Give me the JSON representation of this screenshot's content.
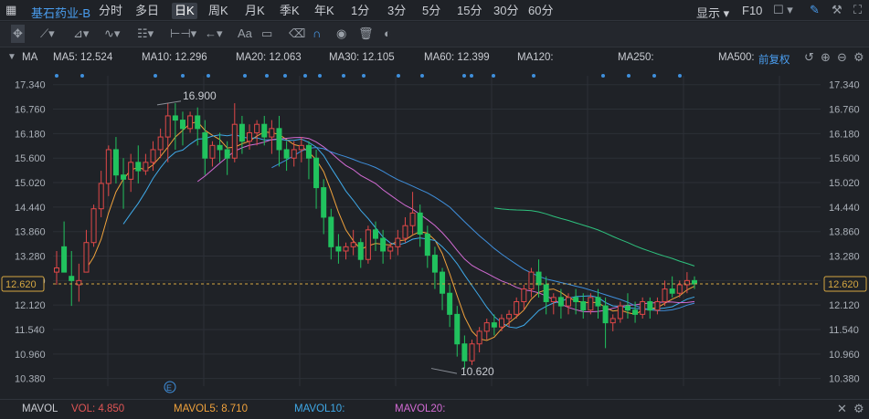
{
  "header": {
    "stock_name": "基石药业-B",
    "tabs": [
      "分时",
      "多日",
      "日K",
      "周K",
      "月K",
      "季K",
      "年K",
      "1分",
      "3分",
      "5分",
      "15分",
      "30分",
      "60分"
    ],
    "active_tab": "日K",
    "display_label": "显示",
    "f10_label": "F10"
  },
  "ma_bar": {
    "label": "MA",
    "ma5": "MA5: 12.524",
    "ma10": "MA10: 12.296",
    "ma20": "MA20: 12.063",
    "ma30": "MA30: 12.105",
    "ma60": "MA60: 12.399",
    "ma120": "MA120:",
    "ma250": "MA250:",
    "ma500": "MA500:",
    "adjust": "前复权"
  },
  "colors": {
    "ma5": "#f0a23c",
    "ma10": "#3fa9e8",
    "ma20": "#d36bd4",
    "ma30": "#3f8fdc",
    "ma60": "#2ec27e",
    "ma120": "#e05555",
    "ma250": "#4fd0e8",
    "ma500": "#8a6a2a",
    "up": "#e04848",
    "down": "#21c25e",
    "current": "#d4a641"
  },
  "chart_data": {
    "type": "candlestick",
    "y_ticks": [
      "17.340",
      "16.760",
      "16.180",
      "15.600",
      "15.020",
      "14.440",
      "13.860",
      "13.280",
      "12.700",
      "12.120",
      "11.540",
      "10.960",
      "10.380"
    ],
    "ylim": [
      10.2,
      17.55
    ],
    "current_price": "12.620",
    "annotation_high": "16.900",
    "annotation_low": "10.620",
    "candles": [
      [
        12.9,
        13.4,
        13.0,
        12.6
      ],
      [
        13.5,
        14.1,
        12.9,
        13.5
      ],
      [
        12.8,
        13.4,
        12.7,
        12.1
      ],
      [
        12.6,
        13.1,
        12.7,
        12.2
      ],
      [
        12.9,
        13.9,
        13.6,
        12.9
      ],
      [
        13.6,
        14.5,
        14.4,
        13.5
      ],
      [
        14.4,
        15.3,
        15.0,
        14.2
      ],
      [
        15.0,
        15.9,
        15.8,
        14.7
      ],
      [
        15.8,
        16.1,
        15.2,
        15.0
      ],
      [
        15.2,
        15.6,
        15.1,
        14.4
      ],
      [
        15.1,
        15.7,
        15.5,
        14.8
      ],
      [
        15.5,
        15.9,
        15.3,
        15.0
      ],
      [
        15.3,
        15.7,
        15.5,
        15.2
      ],
      [
        15.5,
        16.0,
        15.8,
        15.3
      ],
      [
        15.8,
        16.3,
        16.1,
        15.6
      ],
      [
        16.1,
        16.9,
        16.6,
        15.5
      ],
      [
        16.6,
        16.9,
        16.5,
        15.8
      ],
      [
        16.5,
        16.7,
        16.3,
        15.9
      ],
      [
        16.3,
        16.7,
        16.6,
        16.2
      ],
      [
        16.6,
        16.8,
        16.3,
        15.9
      ],
      [
        16.2,
        16.5,
        15.6,
        15.2
      ],
      [
        15.6,
        16.0,
        15.9,
        15.4
      ],
      [
        15.9,
        16.2,
        15.8,
        15.5
      ],
      [
        15.8,
        16.0,
        15.6,
        15.2
      ],
      [
        15.6,
        16.9,
        16.4,
        15.5
      ],
      [
        16.4,
        16.6,
        16.0,
        15.7
      ],
      [
        16.0,
        16.4,
        16.2,
        15.8
      ],
      [
        16.2,
        16.5,
        16.4,
        15.9
      ],
      [
        16.4,
        16.6,
        16.1,
        15.9
      ],
      [
        16.1,
        16.5,
        16.3,
        15.7
      ],
      [
        16.3,
        16.6,
        15.8,
        15.4
      ],
      [
        15.8,
        16.0,
        15.6,
        15.3
      ],
      [
        15.6,
        16.0,
        15.8,
        15.4
      ],
      [
        15.8,
        16.1,
        15.9,
        15.5
      ],
      [
        15.9,
        16.0,
        15.6,
        15.1
      ],
      [
        15.6,
        15.8,
        14.9,
        14.4
      ],
      [
        14.9,
        15.1,
        14.2,
        13.8
      ],
      [
        14.2,
        14.4,
        13.5,
        13.2
      ],
      [
        13.5,
        13.8,
        13.4,
        13.1
      ],
      [
        13.4,
        13.6,
        13.5,
        13.2
      ],
      [
        13.5,
        13.9,
        13.6,
        13.3
      ],
      [
        13.6,
        13.7,
        13.2,
        13.0
      ],
      [
        13.2,
        14.0,
        13.9,
        13.1
      ],
      [
        13.9,
        14.1,
        13.7,
        13.4
      ],
      [
        13.7,
        13.9,
        13.4,
        13.1
      ],
      [
        13.4,
        13.6,
        13.5,
        13.2
      ],
      [
        13.5,
        13.9,
        13.7,
        13.3
      ],
      [
        13.7,
        14.2,
        14.0,
        13.6
      ],
      [
        14.0,
        14.8,
        14.3,
        13.8
      ],
      [
        14.3,
        14.5,
        13.8,
        13.5
      ],
      [
        13.8,
        14.0,
        13.3,
        13.0
      ],
      [
        13.3,
        13.5,
        12.9,
        12.5
      ],
      [
        12.9,
        13.0,
        12.4,
        12.0
      ],
      [
        12.4,
        12.6,
        11.9,
        11.6
      ],
      [
        11.9,
        12.1,
        11.2,
        10.9
      ],
      [
        11.2,
        11.4,
        10.8,
        10.62
      ],
      [
        10.8,
        11.3,
        11.2,
        10.7
      ],
      [
        11.2,
        11.6,
        11.5,
        11.0
      ],
      [
        11.5,
        11.8,
        11.7,
        11.3
      ],
      [
        11.7,
        11.9,
        11.6,
        11.4
      ],
      [
        11.6,
        11.9,
        11.8,
        11.5
      ],
      [
        11.8,
        12.0,
        11.9,
        11.6
      ],
      [
        11.9,
        12.3,
        12.2,
        11.8
      ],
      [
        12.2,
        12.6,
        12.5,
        12.0
      ],
      [
        12.5,
        13.0,
        12.9,
        12.3
      ],
      [
        12.9,
        13.2,
        12.6,
        12.3
      ],
      [
        12.6,
        12.8,
        12.2,
        11.9
      ],
      [
        12.2,
        12.4,
        12.3,
        11.9
      ],
      [
        12.3,
        12.5,
        12.1,
        11.8
      ],
      [
        12.1,
        12.4,
        12.3,
        11.9
      ],
      [
        12.3,
        12.5,
        12.2,
        11.9
      ],
      [
        12.2,
        12.4,
        12.0,
        11.8
      ],
      [
        12.0,
        12.4,
        12.3,
        11.9
      ],
      [
        12.3,
        12.5,
        12.1,
        11.8
      ],
      [
        12.1,
        12.3,
        11.7,
        11.1
      ],
      [
        11.7,
        11.9,
        11.8,
        11.5
      ],
      [
        11.8,
        12.2,
        12.1,
        11.7
      ],
      [
        12.1,
        12.4,
        12.0,
        11.8
      ],
      [
        12.0,
        12.2,
        11.9,
        11.7
      ],
      [
        11.9,
        12.3,
        12.2,
        11.8
      ],
      [
        12.2,
        12.3,
        12.0,
        11.8
      ],
      [
        12.0,
        12.3,
        12.2,
        11.9
      ],
      [
        12.2,
        12.7,
        12.5,
        12.1
      ],
      [
        12.5,
        12.8,
        12.4,
        12.3
      ],
      [
        12.4,
        12.7,
        12.6,
        12.3
      ],
      [
        12.6,
        12.9,
        12.7,
        12.4
      ],
      [
        12.7,
        12.8,
        12.62,
        12.5
      ]
    ]
  },
  "volume_bar": {
    "label": "MAVOL",
    "vol": "VOL: 4.850",
    "mavol5": "MAVOL5: 8.710",
    "mavol10": "MAVOL10:",
    "mavol20": "MAVOL20:"
  }
}
